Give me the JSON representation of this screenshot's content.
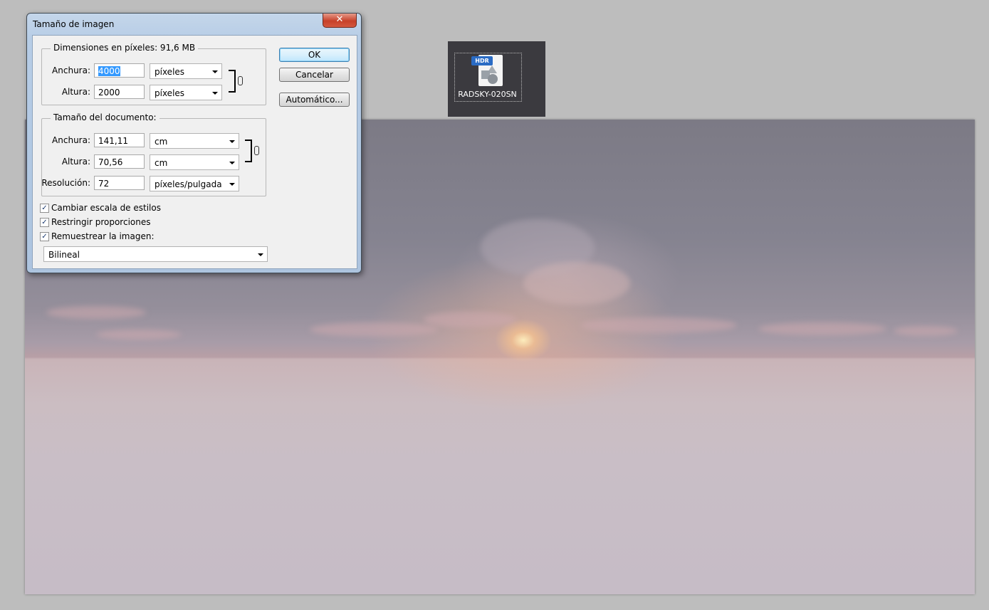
{
  "dialog": {
    "title": "Tamaño de imagen",
    "close_label": "✕",
    "pixel_dims": {
      "legend": "Dimensiones en píxeles: 91,6 MB",
      "width_label": "Anchura:",
      "width_value": "4000",
      "width_unit": "píxeles",
      "height_label": "Altura:",
      "height_value": "2000",
      "height_unit": "píxeles"
    },
    "doc_size": {
      "legend": "Tamaño del documento:",
      "width_label": "Anchura:",
      "width_value": "141,11",
      "width_unit": "cm",
      "height_label": "Altura:",
      "height_value": "70,56",
      "height_unit": "cm",
      "res_label": "Resolución:",
      "res_value": "72",
      "res_unit": "píxeles/pulgada"
    },
    "buttons": {
      "ok": "OK",
      "cancel": "Cancelar",
      "auto": "Automático..."
    },
    "checkboxes": [
      {
        "label": "Cambiar escala de estilos",
        "checked": true
      },
      {
        "label": "Restringir proporciones",
        "checked": true
      },
      {
        "label": "Remuestrear la imagen:",
        "checked": true
      }
    ],
    "resample_method": "Bilineal"
  },
  "file": {
    "badge": "HDR",
    "name": "RADSKY-020SN",
    "icon": "hdr-file-icon"
  },
  "check_mark": "✓"
}
